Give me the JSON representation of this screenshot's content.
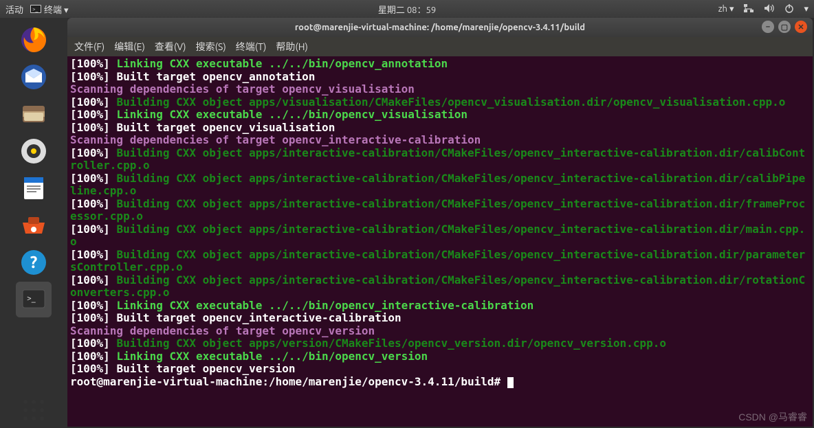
{
  "topbar": {
    "activities": "活动",
    "app_indicator": "终端 ▾",
    "clock": "星期二 08：59",
    "lang": "zh ▾"
  },
  "window": {
    "title": "root@marenjie-virtual-machine: /home/marenjie/opencv-3.4.11/build"
  },
  "menubar": {
    "file": "文件(F)",
    "edit": "编辑(E)",
    "view": "查看(V)",
    "search": "搜索(S)",
    "terminal": "终端(T)",
    "help": "帮助(H)"
  },
  "lines": [
    {
      "pct": "[100%] ",
      "cls": "link",
      "text": "Linking CXX executable ../../bin/opencv_annotation"
    },
    {
      "pct": "[100%] ",
      "cls": "built",
      "text": "Built target opencv_annotation"
    },
    {
      "pct": "",
      "cls": "scan",
      "text": "Scanning dependencies of target opencv_visualisation"
    },
    {
      "pct": "[100%] ",
      "cls": "build",
      "text": "Building CXX object apps/visualisation/CMakeFiles/opencv_visualisation.dir/opencv_visualisation.cpp.o"
    },
    {
      "pct": "[100%] ",
      "cls": "link",
      "text": "Linking CXX executable ../../bin/opencv_visualisation"
    },
    {
      "pct": "[100%] ",
      "cls": "built",
      "text": "Built target opencv_visualisation"
    },
    {
      "pct": "",
      "cls": "scan",
      "text": "Scanning dependencies of target opencv_interactive-calibration"
    },
    {
      "pct": "[100%] ",
      "cls": "build",
      "text": "Building CXX object apps/interactive-calibration/CMakeFiles/opencv_interactive-calibration.dir/calibController.cpp.o"
    },
    {
      "pct": "[100%] ",
      "cls": "build",
      "text": "Building CXX object apps/interactive-calibration/CMakeFiles/opencv_interactive-calibration.dir/calibPipeline.cpp.o"
    },
    {
      "pct": "[100%] ",
      "cls": "build",
      "text": "Building CXX object apps/interactive-calibration/CMakeFiles/opencv_interactive-calibration.dir/frameProcessor.cpp.o"
    },
    {
      "pct": "[100%] ",
      "cls": "build",
      "text": "Building CXX object apps/interactive-calibration/CMakeFiles/opencv_interactive-calibration.dir/main.cpp.o"
    },
    {
      "pct": "[100%] ",
      "cls": "build",
      "text": "Building CXX object apps/interactive-calibration/CMakeFiles/opencv_interactive-calibration.dir/parametersController.cpp.o"
    },
    {
      "pct": "[100%] ",
      "cls": "build",
      "text": "Building CXX object apps/interactive-calibration/CMakeFiles/opencv_interactive-calibration.dir/rotationConverters.cpp.o"
    },
    {
      "pct": "[100%] ",
      "cls": "link",
      "text": "Linking CXX executable ../../bin/opencv_interactive-calibration"
    },
    {
      "pct": "[100%] ",
      "cls": "built",
      "text": "Built target opencv_interactive-calibration"
    },
    {
      "pct": "",
      "cls": "scan",
      "text": "Scanning dependencies of target opencv_version"
    },
    {
      "pct": "[100%] ",
      "cls": "build",
      "text": "Building CXX object apps/version/CMakeFiles/opencv_version.dir/opencv_version.cpp.o"
    },
    {
      "pct": "[100%] ",
      "cls": "link",
      "text": "Linking CXX executable ../../bin/opencv_version"
    },
    {
      "pct": "[100%] ",
      "cls": "built",
      "text": "Built target opencv_version"
    }
  ],
  "prompt": "root@marenjie-virtual-machine:/home/marenjie/opencv-3.4.11/build# ",
  "watermark": "CSDN @马睿睿"
}
